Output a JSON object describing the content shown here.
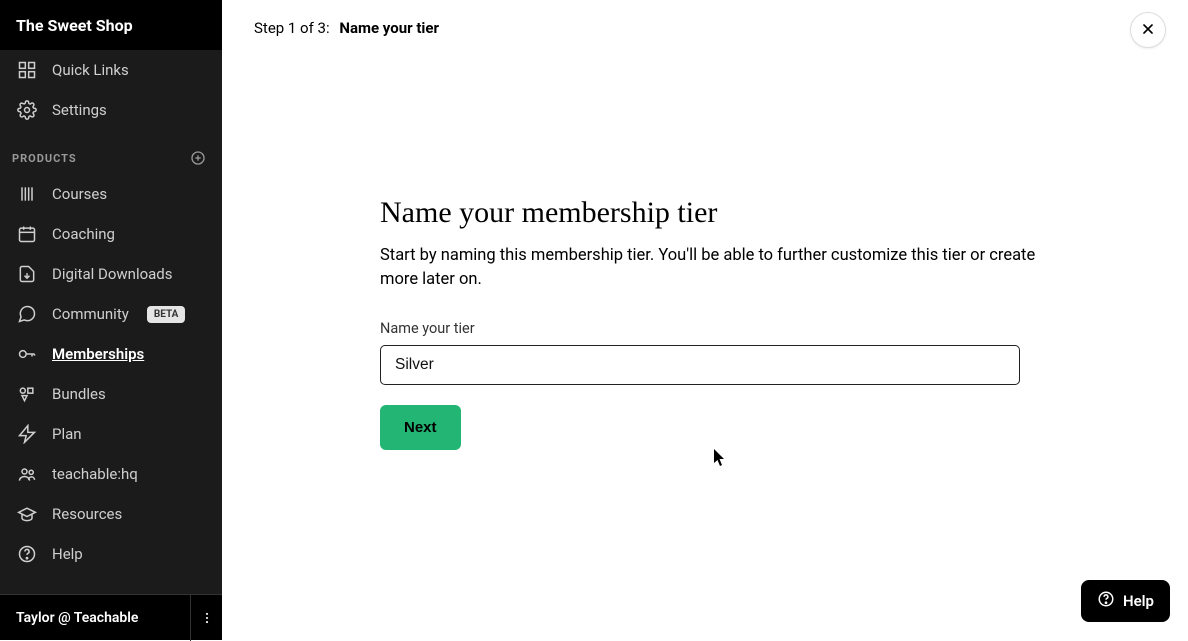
{
  "sidebar": {
    "title": "The Sweet Shop",
    "top_items": [
      {
        "key": "quick-links",
        "label": "Quick Links"
      },
      {
        "key": "settings",
        "label": "Settings"
      }
    ],
    "section_label": "PRODUCTS",
    "product_items": [
      {
        "key": "courses",
        "label": "Courses",
        "active": false,
        "badge": null
      },
      {
        "key": "coaching",
        "label": "Coaching",
        "active": false,
        "badge": null
      },
      {
        "key": "digital-downloads",
        "label": "Digital Downloads",
        "active": false,
        "badge": null
      },
      {
        "key": "community",
        "label": "Community",
        "active": false,
        "badge": "BETA"
      },
      {
        "key": "memberships",
        "label": "Memberships",
        "active": true,
        "badge": null
      },
      {
        "key": "bundles",
        "label": "Bundles",
        "active": false,
        "badge": null
      },
      {
        "key": "plan",
        "label": "Plan",
        "active": false,
        "badge": null
      },
      {
        "key": "teachable-hq",
        "label": "teachable:hq",
        "active": false,
        "badge": null
      },
      {
        "key": "resources",
        "label": "Resources",
        "active": false,
        "badge": null
      },
      {
        "key": "help",
        "label": "Help",
        "active": false,
        "badge": null
      }
    ],
    "footer_user": "Taylor @ Teachable"
  },
  "wizard": {
    "step_text": "Step 1 of 3:",
    "step_title": "Name your tier"
  },
  "form": {
    "heading": "Name your membership tier",
    "description": "Start by naming this membership tier. You'll be able to further customize this tier or create more later on.",
    "field_label": "Name your tier",
    "field_value": "Silver",
    "next_label": "Next"
  },
  "help_pill": {
    "label": "Help"
  },
  "colors": {
    "accent": "#22b573",
    "sidebar_bg": "#1b1b1b"
  }
}
